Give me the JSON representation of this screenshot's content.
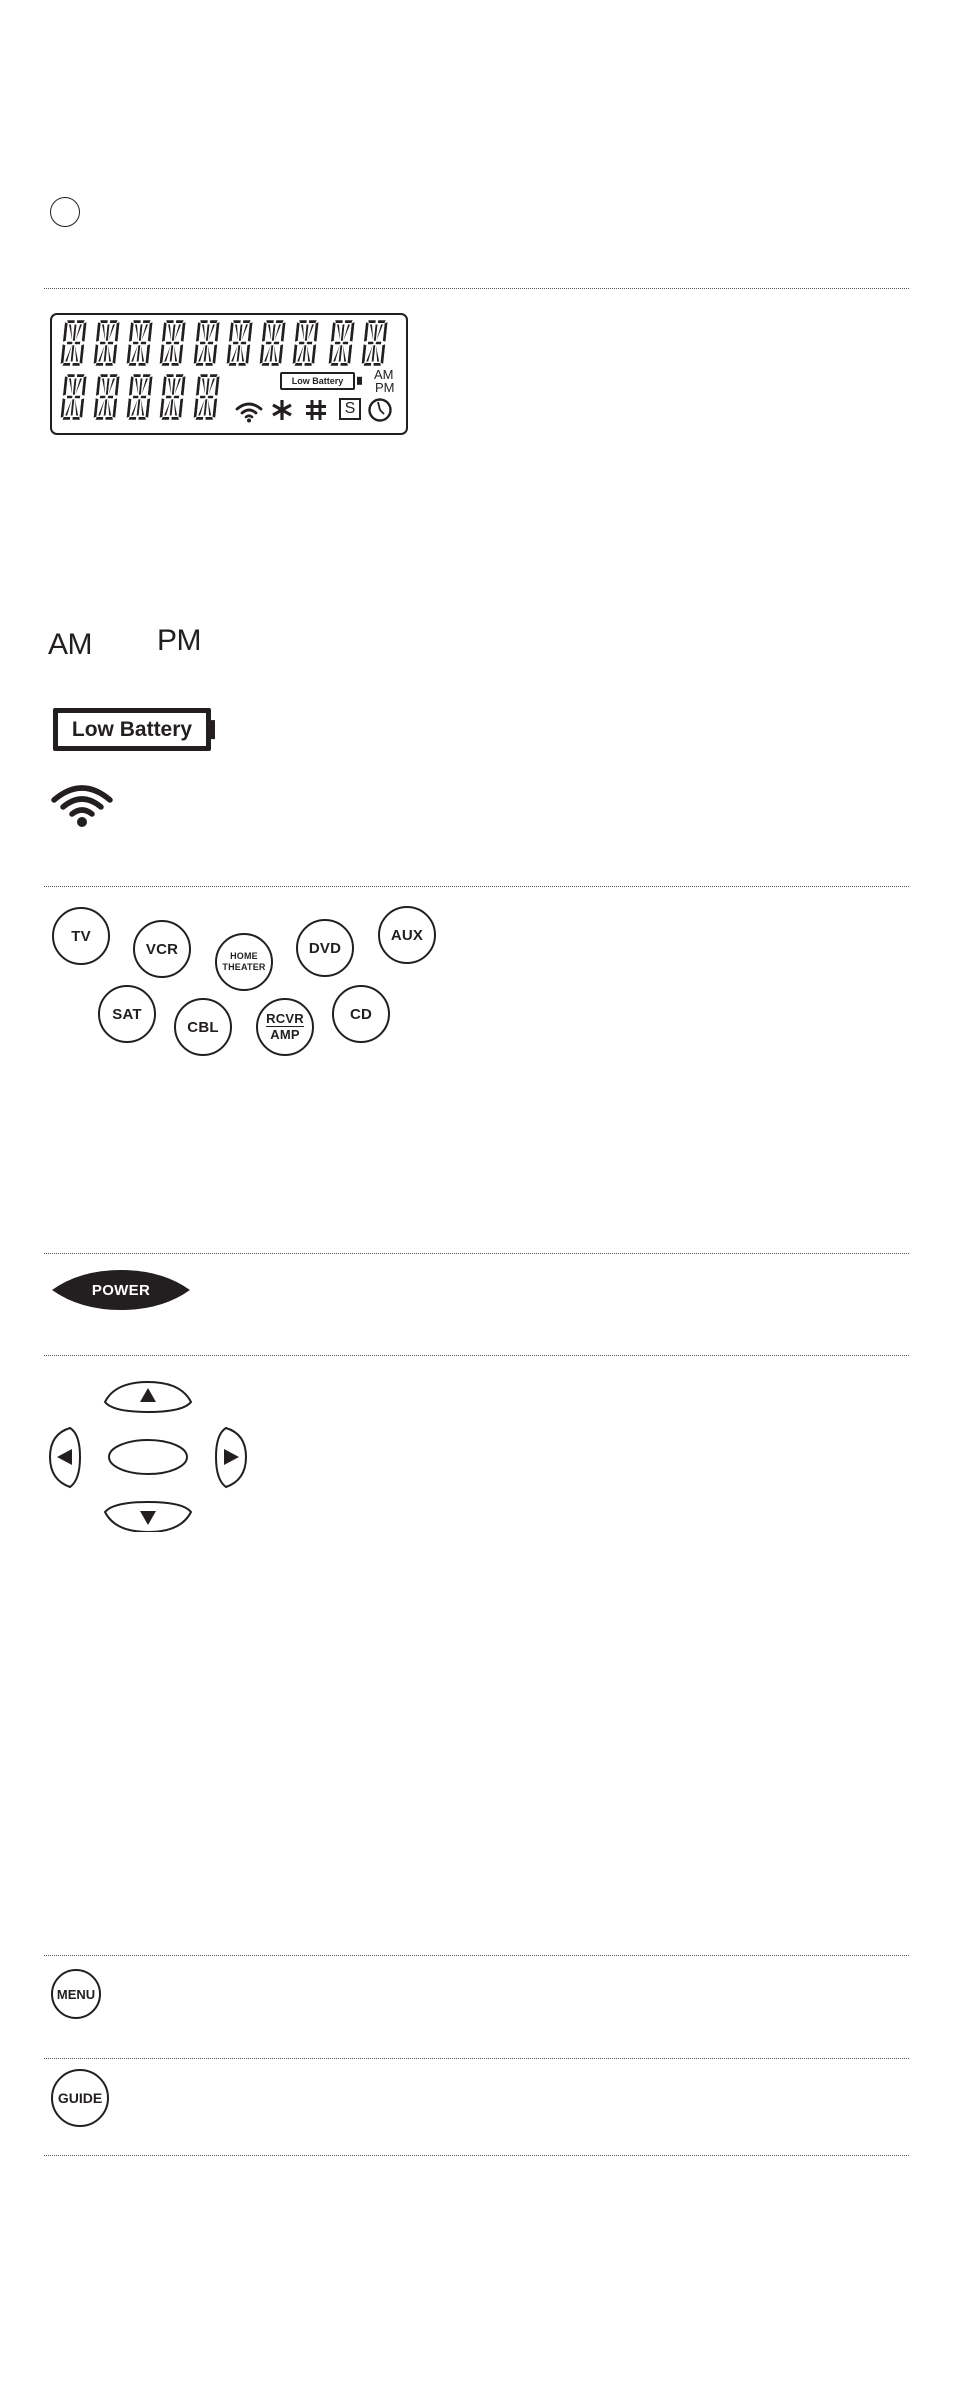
{
  "document": {
    "top_blank_circle_icon": "circle-outline",
    "lcd_display": {
      "row1_char_count": 10,
      "row2_char_count": 5,
      "low_battery_label": "Low Battery",
      "am_label": "AM",
      "pm_label": "PM",
      "icons": [
        "signal-icon",
        "asterisk-icon",
        "hash-icon",
        "s-box-icon",
        "clock-icon"
      ],
      "s_label": "S"
    },
    "indicators": {
      "am_label": "AM",
      "pm_label": "PM",
      "low_battery_label": "Low Battery",
      "signal_icon": "signal-icon"
    },
    "source_buttons": [
      {
        "label": "TV"
      },
      {
        "label": "VCR"
      },
      {
        "label": "HOME THEATER",
        "line1": "HOME",
        "line2": "THEATER"
      },
      {
        "label": "DVD"
      },
      {
        "label": "AUX"
      },
      {
        "label": "SAT"
      },
      {
        "label": "CBL"
      },
      {
        "label": "RCVR/AMP",
        "line1": "RCVR",
        "line2": "AMP"
      },
      {
        "label": "CD"
      }
    ],
    "power_button": {
      "label": "POWER"
    },
    "navigation_pad": {
      "up_icon": "arrow-up-icon",
      "down_icon": "arrow-down-icon",
      "left_icon": "arrow-left-icon",
      "right_icon": "arrow-right-icon",
      "center": "ok-button"
    },
    "menu_button": {
      "label": "MENU"
    },
    "guide_button": {
      "label": "GUIDE"
    }
  }
}
